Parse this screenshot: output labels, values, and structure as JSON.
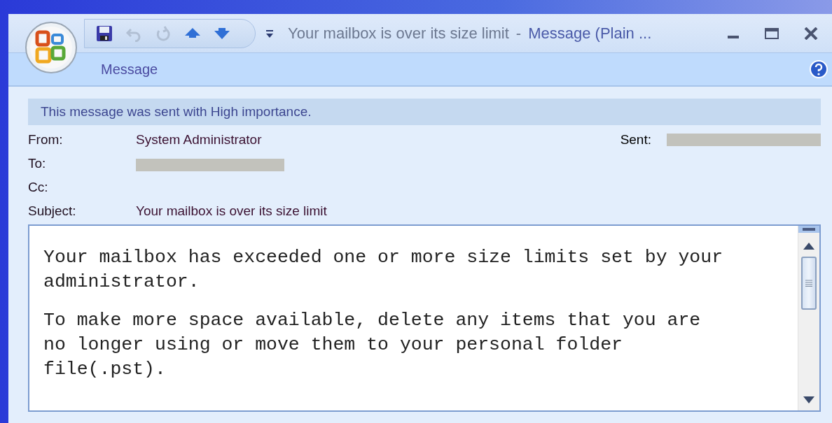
{
  "window": {
    "title_subject": "Your mailbox is over its size limit",
    "title_separator": "-",
    "title_app": "Message (Plain ..."
  },
  "quick_access": [
    {
      "kind": "save",
      "disabled": false
    },
    {
      "kind": "undo",
      "disabled": true
    },
    {
      "kind": "redo",
      "disabled": true
    },
    {
      "kind": "previous",
      "disabled": false
    },
    {
      "kind": "next",
      "disabled": false
    }
  ],
  "ribbon": {
    "tabs": [
      {
        "label": "Message"
      }
    ]
  },
  "infobar": "This message was sent with High importance.",
  "header": {
    "fields": [
      {
        "label": "From:",
        "value": "System Administrator"
      },
      {
        "label": "To:",
        "redacted": true
      },
      {
        "label": "Cc:"
      },
      {
        "label": "Subject:",
        "value": "Your mailbox is over its size limit"
      }
    ],
    "sent": {
      "label": "Sent:",
      "redacted": true
    }
  },
  "body": {
    "paragraphs": [
      "Your mailbox has exceeded one or more size limits set by your administrator.",
      "To make more space available, delete any items that you are no longer using or move them to your personal folder file(.pst)."
    ]
  }
}
